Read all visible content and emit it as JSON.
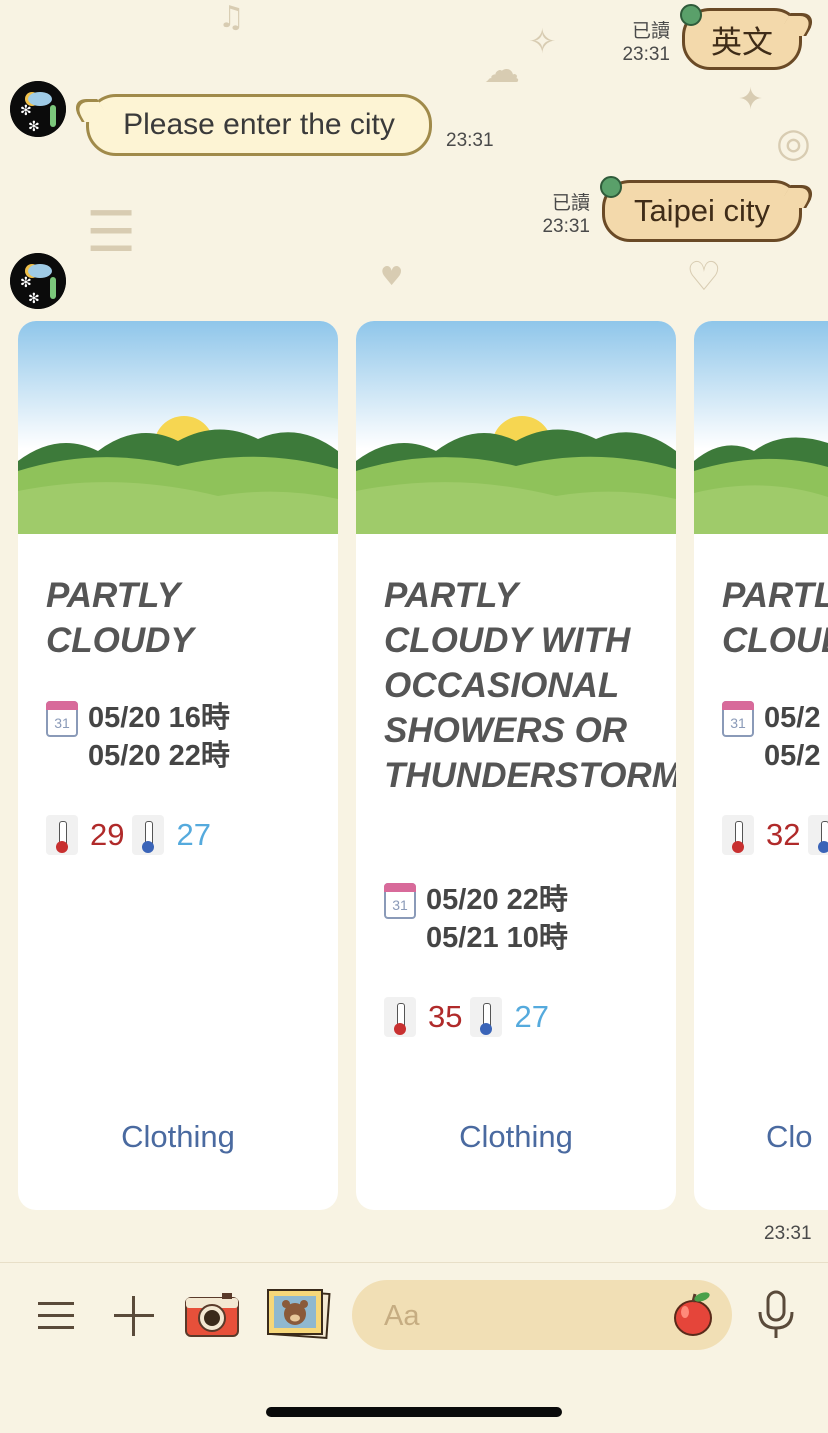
{
  "messages": [
    {
      "side": "out",
      "read": "已讀",
      "time": "23:31",
      "text": "英文"
    },
    {
      "side": "in",
      "time": "23:31",
      "text": "Please enter the city"
    },
    {
      "side": "out",
      "read": "已讀",
      "time": "23:31",
      "text": "Taipei city"
    }
  ],
  "cards": [
    {
      "condition": "Partly cloudy",
      "calendar_day": "31",
      "start": "05/20 16時",
      "end": "05/20 22時",
      "high": "29",
      "low": "27",
      "action": "Clothing"
    },
    {
      "condition": "Partly cloudy with occasional showers or thunderstorms",
      "calendar_day": "31",
      "start": "05/20 22時",
      "end": "05/21 10時",
      "high": "35",
      "low": "27",
      "action": "Clothing"
    },
    {
      "condition": "Partly cloudy",
      "calendar_day": "31",
      "start": "05/2",
      "end": "05/2",
      "high": "32",
      "low": "",
      "action": "Clo"
    }
  ],
  "carousel_time": "23:31",
  "composer": {
    "placeholder": "Aa",
    "icons": [
      "menu-icon",
      "plus-icon",
      "camera-icon",
      "photo-album-icon",
      "apple-sticker-icon",
      "microphone-icon"
    ]
  },
  "colors": {
    "background": "#f8f3e3",
    "outgoing_bubble": "#f3d9ab",
    "incoming_bubble": "#fdf4d4",
    "link": "#4a6aa0",
    "high_temp": "#b02a2a",
    "low_temp": "#55aadd"
  }
}
